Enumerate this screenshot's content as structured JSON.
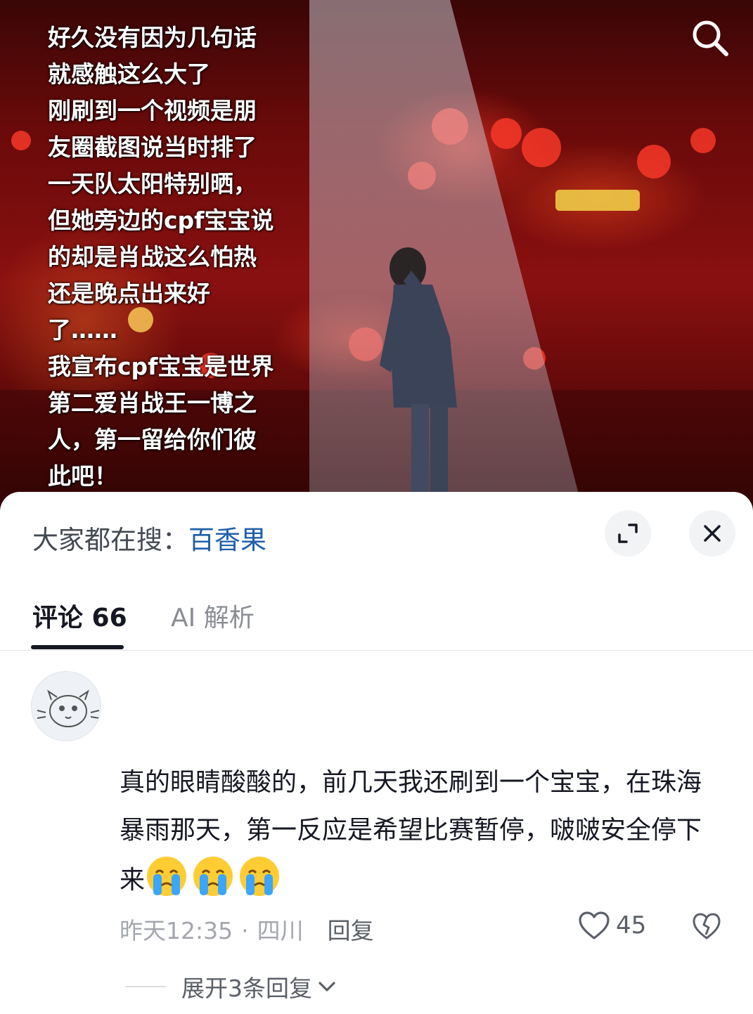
{
  "hero": {
    "caption": "好久没有因为几句话\n就感触这么大了\n刚刷到一个视频是朋\n友圈截图说当时排了\n一天队太阳特别晒，\n但她旁边的cpf宝宝说\n的却是肖战这么怕热\n还是晚点出来好\n了……\n我宣布cpf宝宝是世界\n第二爱肖战王一博之\n人，第一留给你们彼\n此吧！",
    "search_icon": "search-icon"
  },
  "sheet": {
    "trending_prefix": "大家都在搜：",
    "trending_keyword": "百香果",
    "expand_icon": "expand-icon",
    "close_icon": "close-icon"
  },
  "tabs": [
    {
      "label": "评论 66",
      "active": true
    },
    {
      "label": "AI 解析",
      "active": false
    }
  ],
  "comment": {
    "text": "真的眼睛酸酸的，前几天我还刷到一个宝宝，在珠海暴雨那天，第一反应是希望比赛暂停，啵啵安全停下来",
    "emojis": [
      "crying-emoji",
      "crying-emoji",
      "crying-emoji"
    ],
    "time": "昨天12:35",
    "location": "四川",
    "reply_label": "回复",
    "like_count": "45",
    "expand_replies_label": "展开3条回复"
  },
  "colors": {
    "accent_link": "#1f5fa8",
    "primary_text": "#161823",
    "secondary_text": "#a4a7ad"
  }
}
